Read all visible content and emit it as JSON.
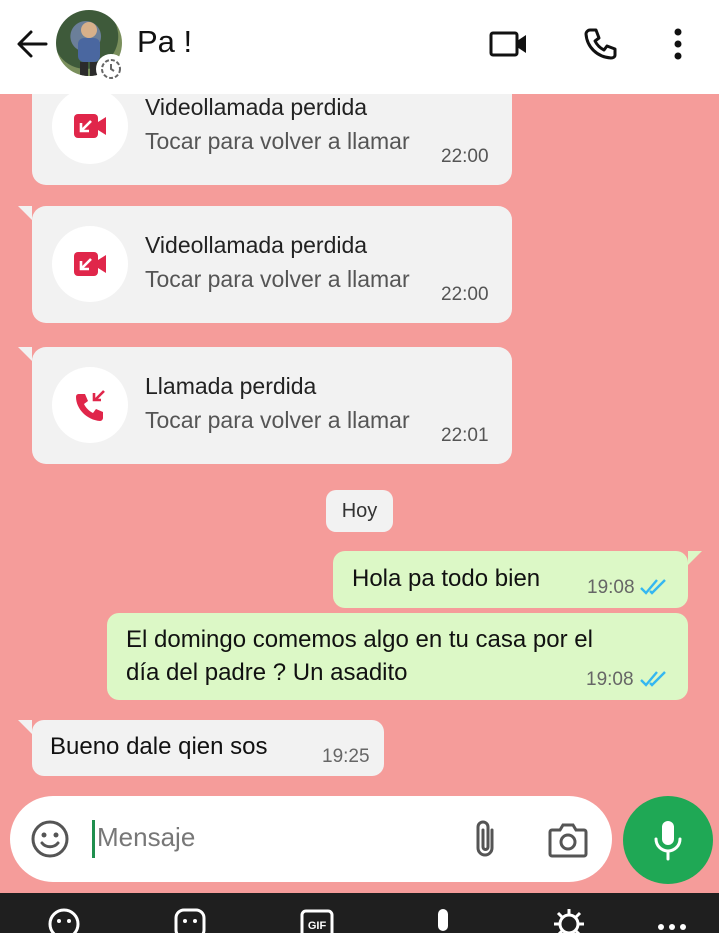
{
  "header": {
    "contact_name": "Pa !",
    "icons": [
      "back-arrow-icon",
      "status-badge-icon",
      "video-call-icon",
      "voice-call-icon",
      "more-options-icon"
    ]
  },
  "calls": [
    {
      "title": "Videollamada perdida",
      "subtitle": "Tocar para volver a llamar",
      "time": "22:00",
      "kind": "video"
    },
    {
      "title": "Videollamada perdida",
      "subtitle": "Tocar para volver a llamar",
      "time": "22:00",
      "kind": "video"
    },
    {
      "title": "Llamada perdida",
      "subtitle": "Tocar para volver a llamar",
      "time": "22:01",
      "kind": "voice"
    }
  ],
  "day_chip": "Hoy",
  "messages": [
    {
      "direction": "out",
      "lines": [
        "Hola pa todo bien"
      ],
      "time": "19:08",
      "status": "read"
    },
    {
      "direction": "out",
      "lines": [
        "El domingo comemos algo en tu casa por el",
        "día del padre ? Un asadito"
      ],
      "time": "19:08",
      "status": "read"
    },
    {
      "direction": "in",
      "lines": [
        "Bueno dale qien sos"
      ],
      "time": "19:25"
    }
  ],
  "input": {
    "placeholder": "Mensaje",
    "icons": [
      "emoji-icon",
      "attach-icon",
      "camera-icon",
      "mic-icon"
    ]
  },
  "keyboard_toolbar": {
    "items": [
      "emoji-icon",
      "sticker-icon",
      "gif-icon",
      "voice-input-icon",
      "settings-icon",
      "more-icon"
    ],
    "gif_label": "GIF"
  },
  "colors": {
    "chat_background": "#f59c9a",
    "outgoing_bubble": "#dcf8c6",
    "incoming_bubble": "#f2f2f2",
    "missed_call_red": "#e0264a",
    "read_ticks": "#34b7f1",
    "mic_fab": "#1fa855"
  }
}
